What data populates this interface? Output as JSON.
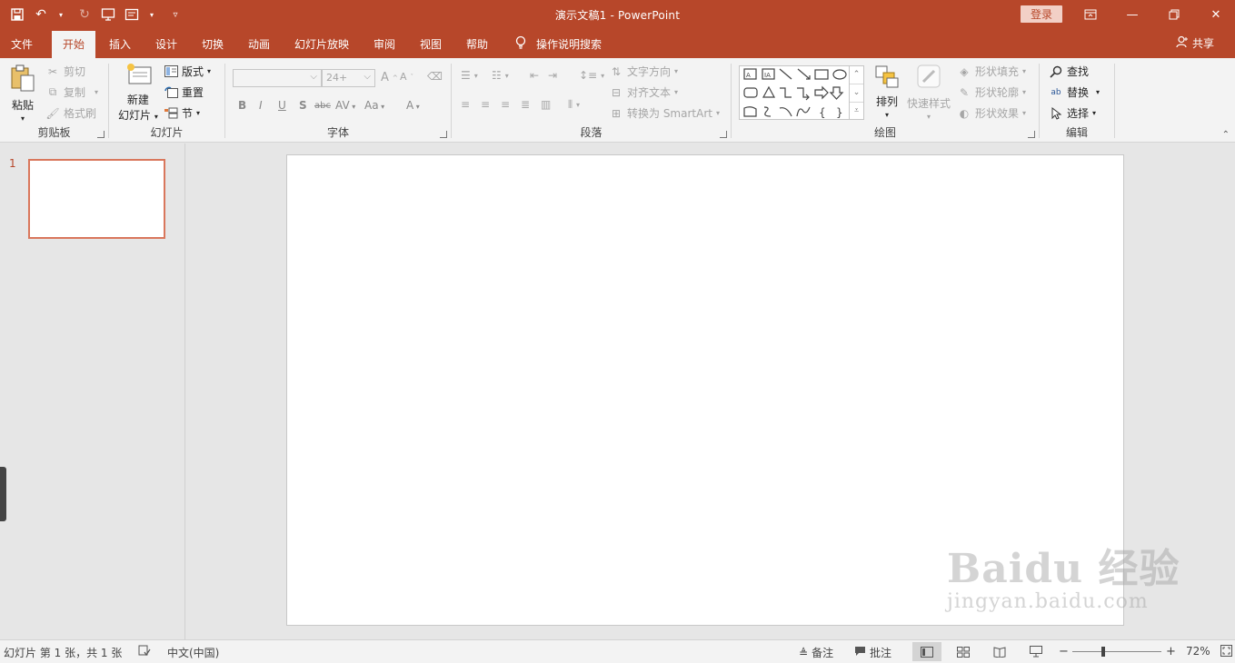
{
  "titlebar": {
    "title": "演示文稿1  -  PowerPoint",
    "signin": "登录",
    "qat_dropdown": "▾"
  },
  "tabs": [
    {
      "label": "文件"
    },
    {
      "label": "开始"
    },
    {
      "label": "插入"
    },
    {
      "label": "设计"
    },
    {
      "label": "切换"
    },
    {
      "label": "动画"
    },
    {
      "label": "幻灯片放映"
    },
    {
      "label": "审阅"
    },
    {
      "label": "视图"
    },
    {
      "label": "帮助"
    }
  ],
  "tellme": "操作说明搜索",
  "share": "共享",
  "ribbon": {
    "clipboard": {
      "label": "剪贴板",
      "paste": "粘贴",
      "cut": "剪切",
      "copy": "复制",
      "format_painter": "格式刷"
    },
    "slides": {
      "label": "幻灯片",
      "new_slide_1": "新建",
      "new_slide_2": "幻灯片",
      "layout": "版式",
      "reset": "重置",
      "section": "节"
    },
    "font": {
      "label": "字体",
      "font_name": "",
      "font_size": "24+",
      "bold": "B",
      "italic": "I",
      "underline": "U",
      "shadow": "S",
      "strike": "abc",
      "spacing": "AV",
      "case": "Aa",
      "color": "A"
    },
    "paragraph": {
      "label": "段落",
      "text_direction": "文字方向",
      "align_text": "对齐文本",
      "smartart": "转换为 SmartArt"
    },
    "drawing": {
      "label": "绘图",
      "arrange": "排列",
      "quick_styles": "快速样式",
      "shape_fill": "形状填充",
      "shape_outline": "形状轮廓",
      "shape_effects": "形状效果"
    },
    "editing": {
      "label": "编辑",
      "find": "查找",
      "replace": "替换",
      "select": "选择"
    }
  },
  "thumbs": {
    "slide_number": "1"
  },
  "watermark": {
    "line1": "Baidu 经验",
    "line2": "jingyan.baidu.com"
  },
  "statusbar": {
    "slide_info": "幻灯片 第 1 张，共 1 张",
    "language": "中文(中国)",
    "notes": "备注",
    "comments": "批注",
    "zoom": "72%",
    "zoom_minus": "−",
    "zoom_plus": "+"
  },
  "colors": {
    "accent": "#b7472a",
    "ribbon_bg": "#f3f3f3",
    "workspace_bg": "#e6e6e6"
  }
}
